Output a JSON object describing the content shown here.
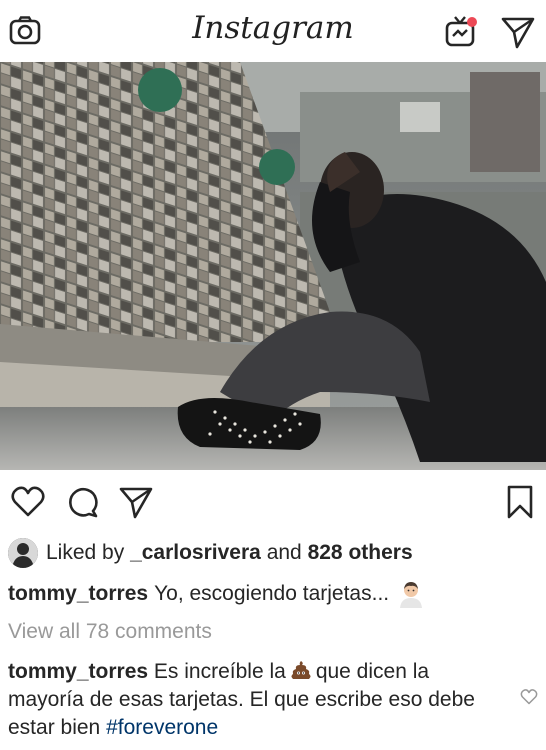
{
  "header": {
    "app_title": "Instagram",
    "icons": [
      "camera-icon",
      "igtv-icon",
      "send-icon"
    ],
    "notification_dot_color": "#ed4956"
  },
  "post": {
    "image_alt_description": "",
    "actions": {
      "icons": [
        "heart-icon",
        "comment-icon",
        "share-icon",
        "bookmark-icon"
      ]
    },
    "likes": {
      "prefix": "Liked by",
      "user": "_carlosrivera",
      "and": "and",
      "others": "828 others"
    },
    "caption": {
      "username": "tommy_torres",
      "text": "Yo, escogiendo tarjetas..."
    },
    "view_all_comments": "View all 78 comments",
    "comment": {
      "username": "tommy_torres",
      "text_before_emoji": "Es increíble la",
      "text_after_emoji": "que dicen la mayoría de esas tarjetas.  El que escribe eso debe estar bien",
      "hashtag": "#foreverone"
    }
  }
}
